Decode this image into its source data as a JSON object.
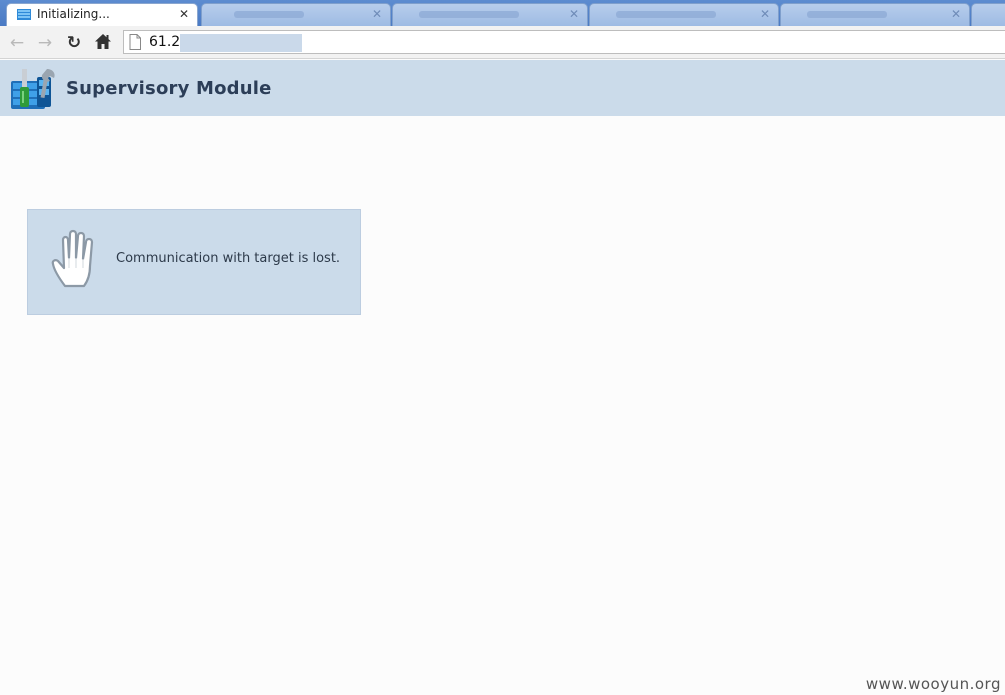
{
  "browser": {
    "active_tab": {
      "title": "Initializing...",
      "close_glyph": "✕"
    },
    "background_tab_count": 5,
    "toolbar": {
      "back_glyph": "←",
      "forward_glyph": "→",
      "reload_glyph": "↻",
      "url": "61.2"
    }
  },
  "header": {
    "title": "Supervisory Module"
  },
  "message": {
    "text": "Communication with target is lost."
  },
  "watermark": "www.wooyun.org",
  "colors": {
    "header_bg": "#cbdbea",
    "panel_bg": "#cbdbea",
    "title_text": "#2c3e58",
    "tabstrip": "#4a7ac4"
  }
}
